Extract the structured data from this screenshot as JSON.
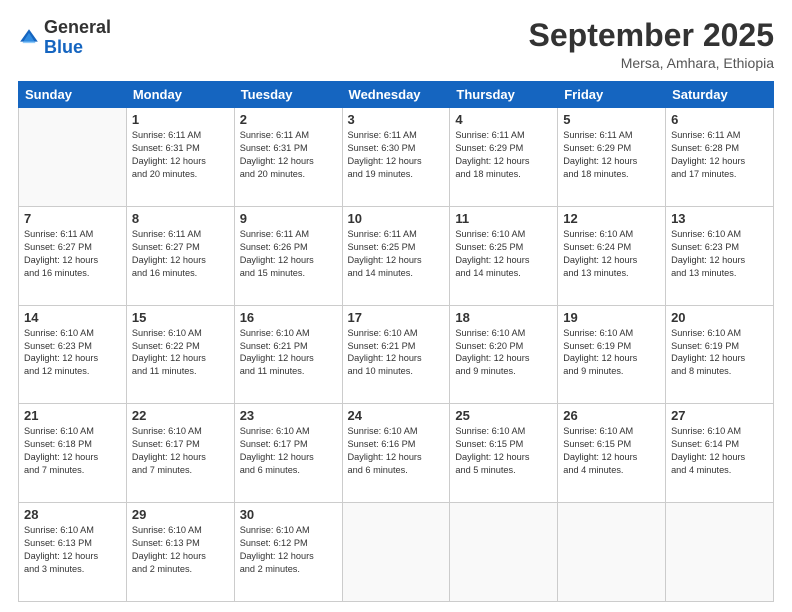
{
  "header": {
    "logo_general": "General",
    "logo_blue": "Blue",
    "month_title": "September 2025",
    "location": "Mersa, Amhara, Ethiopia"
  },
  "weekdays": [
    "Sunday",
    "Monday",
    "Tuesday",
    "Wednesday",
    "Thursday",
    "Friday",
    "Saturday"
  ],
  "weeks": [
    [
      {
        "day": "",
        "info": ""
      },
      {
        "day": "1",
        "info": "Sunrise: 6:11 AM\nSunset: 6:31 PM\nDaylight: 12 hours\nand 20 minutes."
      },
      {
        "day": "2",
        "info": "Sunrise: 6:11 AM\nSunset: 6:31 PM\nDaylight: 12 hours\nand 20 minutes."
      },
      {
        "day": "3",
        "info": "Sunrise: 6:11 AM\nSunset: 6:30 PM\nDaylight: 12 hours\nand 19 minutes."
      },
      {
        "day": "4",
        "info": "Sunrise: 6:11 AM\nSunset: 6:29 PM\nDaylight: 12 hours\nand 18 minutes."
      },
      {
        "day": "5",
        "info": "Sunrise: 6:11 AM\nSunset: 6:29 PM\nDaylight: 12 hours\nand 18 minutes."
      },
      {
        "day": "6",
        "info": "Sunrise: 6:11 AM\nSunset: 6:28 PM\nDaylight: 12 hours\nand 17 minutes."
      }
    ],
    [
      {
        "day": "7",
        "info": "Sunrise: 6:11 AM\nSunset: 6:27 PM\nDaylight: 12 hours\nand 16 minutes."
      },
      {
        "day": "8",
        "info": "Sunrise: 6:11 AM\nSunset: 6:27 PM\nDaylight: 12 hours\nand 16 minutes."
      },
      {
        "day": "9",
        "info": "Sunrise: 6:11 AM\nSunset: 6:26 PM\nDaylight: 12 hours\nand 15 minutes."
      },
      {
        "day": "10",
        "info": "Sunrise: 6:11 AM\nSunset: 6:25 PM\nDaylight: 12 hours\nand 14 minutes."
      },
      {
        "day": "11",
        "info": "Sunrise: 6:10 AM\nSunset: 6:25 PM\nDaylight: 12 hours\nand 14 minutes."
      },
      {
        "day": "12",
        "info": "Sunrise: 6:10 AM\nSunset: 6:24 PM\nDaylight: 12 hours\nand 13 minutes."
      },
      {
        "day": "13",
        "info": "Sunrise: 6:10 AM\nSunset: 6:23 PM\nDaylight: 12 hours\nand 13 minutes."
      }
    ],
    [
      {
        "day": "14",
        "info": "Sunrise: 6:10 AM\nSunset: 6:23 PM\nDaylight: 12 hours\nand 12 minutes."
      },
      {
        "day": "15",
        "info": "Sunrise: 6:10 AM\nSunset: 6:22 PM\nDaylight: 12 hours\nand 11 minutes."
      },
      {
        "day": "16",
        "info": "Sunrise: 6:10 AM\nSunset: 6:21 PM\nDaylight: 12 hours\nand 11 minutes."
      },
      {
        "day": "17",
        "info": "Sunrise: 6:10 AM\nSunset: 6:21 PM\nDaylight: 12 hours\nand 10 minutes."
      },
      {
        "day": "18",
        "info": "Sunrise: 6:10 AM\nSunset: 6:20 PM\nDaylight: 12 hours\nand 9 minutes."
      },
      {
        "day": "19",
        "info": "Sunrise: 6:10 AM\nSunset: 6:19 PM\nDaylight: 12 hours\nand 9 minutes."
      },
      {
        "day": "20",
        "info": "Sunrise: 6:10 AM\nSunset: 6:19 PM\nDaylight: 12 hours\nand 8 minutes."
      }
    ],
    [
      {
        "day": "21",
        "info": "Sunrise: 6:10 AM\nSunset: 6:18 PM\nDaylight: 12 hours\nand 7 minutes."
      },
      {
        "day": "22",
        "info": "Sunrise: 6:10 AM\nSunset: 6:17 PM\nDaylight: 12 hours\nand 7 minutes."
      },
      {
        "day": "23",
        "info": "Sunrise: 6:10 AM\nSunset: 6:17 PM\nDaylight: 12 hours\nand 6 minutes."
      },
      {
        "day": "24",
        "info": "Sunrise: 6:10 AM\nSunset: 6:16 PM\nDaylight: 12 hours\nand 6 minutes."
      },
      {
        "day": "25",
        "info": "Sunrise: 6:10 AM\nSunset: 6:15 PM\nDaylight: 12 hours\nand 5 minutes."
      },
      {
        "day": "26",
        "info": "Sunrise: 6:10 AM\nSunset: 6:15 PM\nDaylight: 12 hours\nand 4 minutes."
      },
      {
        "day": "27",
        "info": "Sunrise: 6:10 AM\nSunset: 6:14 PM\nDaylight: 12 hours\nand 4 minutes."
      }
    ],
    [
      {
        "day": "28",
        "info": "Sunrise: 6:10 AM\nSunset: 6:13 PM\nDaylight: 12 hours\nand 3 minutes."
      },
      {
        "day": "29",
        "info": "Sunrise: 6:10 AM\nSunset: 6:13 PM\nDaylight: 12 hours\nand 2 minutes."
      },
      {
        "day": "30",
        "info": "Sunrise: 6:10 AM\nSunset: 6:12 PM\nDaylight: 12 hours\nand 2 minutes."
      },
      {
        "day": "",
        "info": ""
      },
      {
        "day": "",
        "info": ""
      },
      {
        "day": "",
        "info": ""
      },
      {
        "day": "",
        "info": ""
      }
    ]
  ]
}
